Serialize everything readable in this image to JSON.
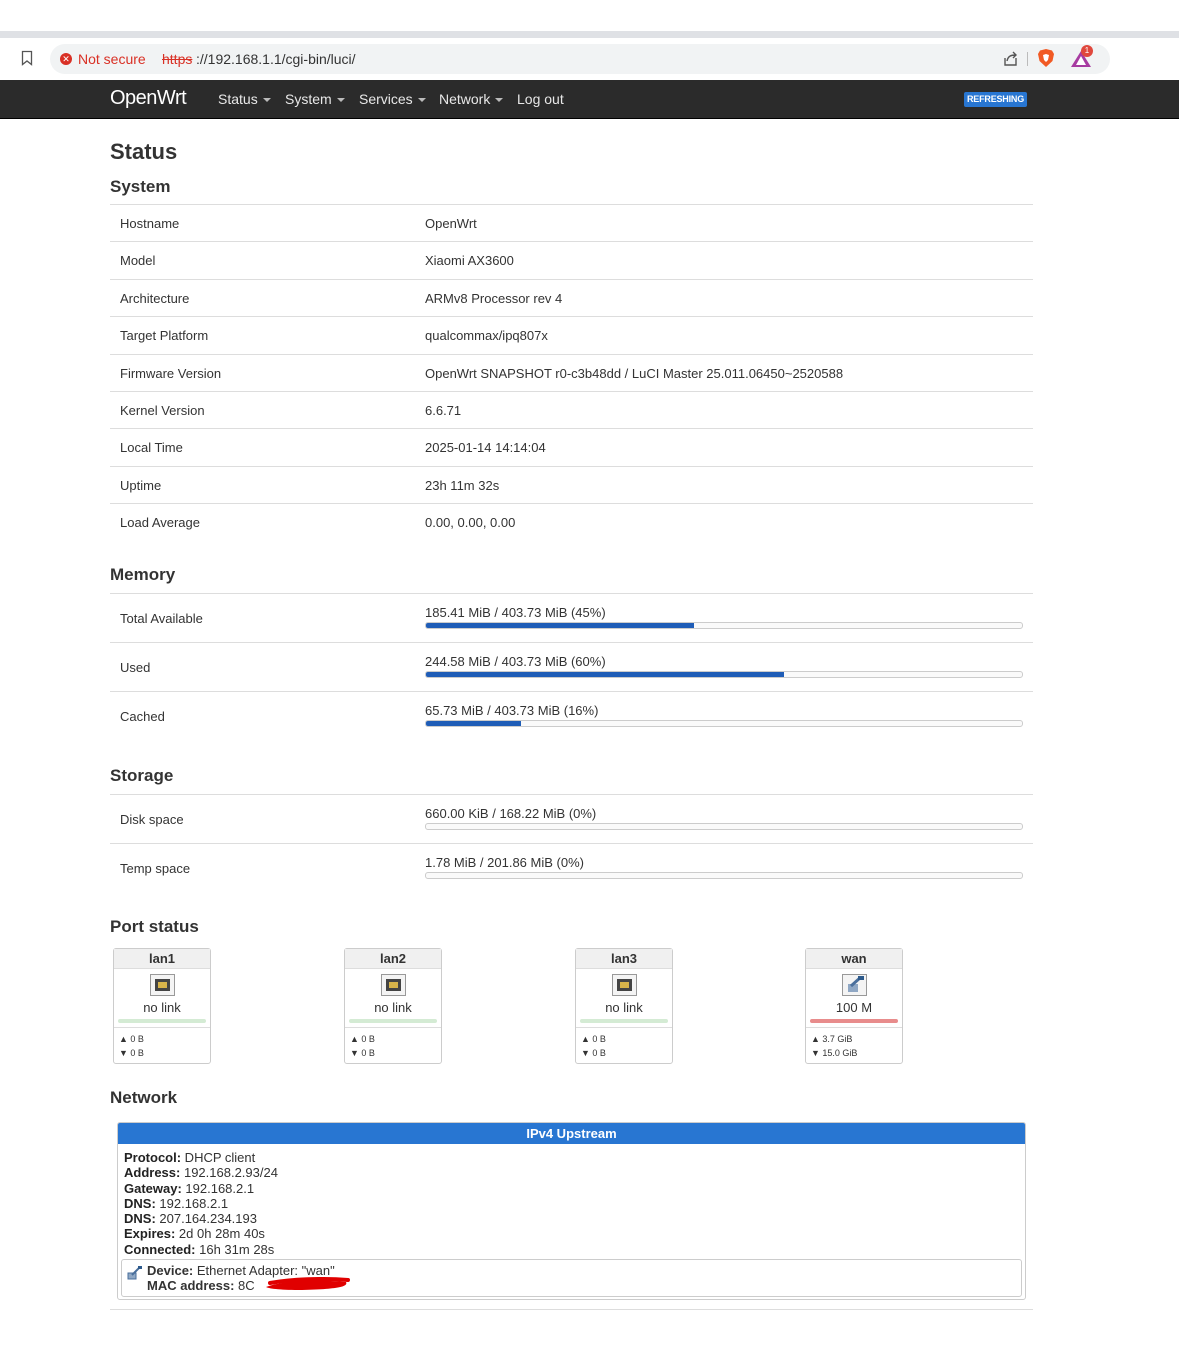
{
  "browser": {
    "security_label": "Not secure",
    "url_scheme": "https",
    "url_rest": "://192.168.1.1/cgi-bin/luci/",
    "rewards_count": "1"
  },
  "header": {
    "brand": "OpenWrt",
    "nav": [
      "Status",
      "System",
      "Services",
      "Network",
      "Log out"
    ],
    "indicator": "REFRESHING"
  },
  "page_title": "Status",
  "system": {
    "title": "System",
    "rows": [
      {
        "label": "Hostname",
        "value": "OpenWrt"
      },
      {
        "label": "Model",
        "value": "Xiaomi AX3600"
      },
      {
        "label": "Architecture",
        "value": "ARMv8 Processor rev 4"
      },
      {
        "label": "Target Platform",
        "value": "qualcommax/ipq807x"
      },
      {
        "label": "Firmware Version",
        "value": "OpenWrt SNAPSHOT r0-c3b48dd / LuCI Master 25.011.06450~2520588"
      },
      {
        "label": "Kernel Version",
        "value": "6.6.71"
      },
      {
        "label": "Local Time",
        "value": "2025-01-14 14:14:04"
      },
      {
        "label": "Uptime",
        "value": "23h 11m 32s"
      },
      {
        "label": "Load Average",
        "value": "0.00, 0.00, 0.00"
      }
    ]
  },
  "memory": {
    "title": "Memory",
    "rows": [
      {
        "label": "Total Available",
        "text": "185.41 MiB / 403.73 MiB (45%)",
        "percent": 45
      },
      {
        "label": "Used",
        "text": "244.58 MiB / 403.73 MiB (60%)",
        "percent": 60
      },
      {
        "label": "Cached",
        "text": "65.73 MiB / 403.73 MiB (16%)",
        "percent": 16
      }
    ]
  },
  "storage": {
    "title": "Storage",
    "rows": [
      {
        "label": "Disk space",
        "text": "660.00 KiB / 168.22 MiB (0%)",
        "percent": 0
      },
      {
        "label": "Temp space",
        "text": "1.78 MiB / 201.86 MiB (0%)",
        "percent": 0
      }
    ]
  },
  "ports": {
    "title": "Port status",
    "items": [
      {
        "name": "lan1",
        "speed": "no link",
        "tx": "▲ 0 B",
        "rx": "▼ 0 B",
        "link_color": "#d4ebd4"
      },
      {
        "name": "lan2",
        "speed": "no link",
        "tx": "▲ 0 B",
        "rx": "▼ 0 B",
        "link_color": "#d4ebd4"
      },
      {
        "name": "lan3",
        "speed": "no link",
        "tx": "▲ 0 B",
        "rx": "▼ 0 B",
        "link_color": "#d4ebd4"
      },
      {
        "name": "wan",
        "speed": "100 M",
        "tx": "▲ 3.7 GiB",
        "rx": "▼ 15.0 GiB",
        "link_color": "#e88c8c"
      }
    ]
  },
  "network": {
    "title": "Network",
    "box_title": "IPv4 Upstream",
    "fields": [
      {
        "key": "Protocol:",
        "value": " DHCP client"
      },
      {
        "key": "Address:",
        "value": " 192.168.2.93/24"
      },
      {
        "key": "Gateway:",
        "value": " 192.168.2.1"
      },
      {
        "key": "DNS:",
        "value": " 192.168.2.1"
      },
      {
        "key": "DNS:",
        "value": " 207.164.234.193"
      },
      {
        "key": "Expires:",
        "value": " 2d 0h 28m 40s"
      },
      {
        "key": "Connected:",
        "value": " 16h 31m 28s"
      }
    ],
    "device": {
      "device_key": "Device:",
      "device_value": " Ethernet Adapter: \"wan\"",
      "mac_key": "MAC address:",
      "mac_value": " 8C"
    }
  }
}
